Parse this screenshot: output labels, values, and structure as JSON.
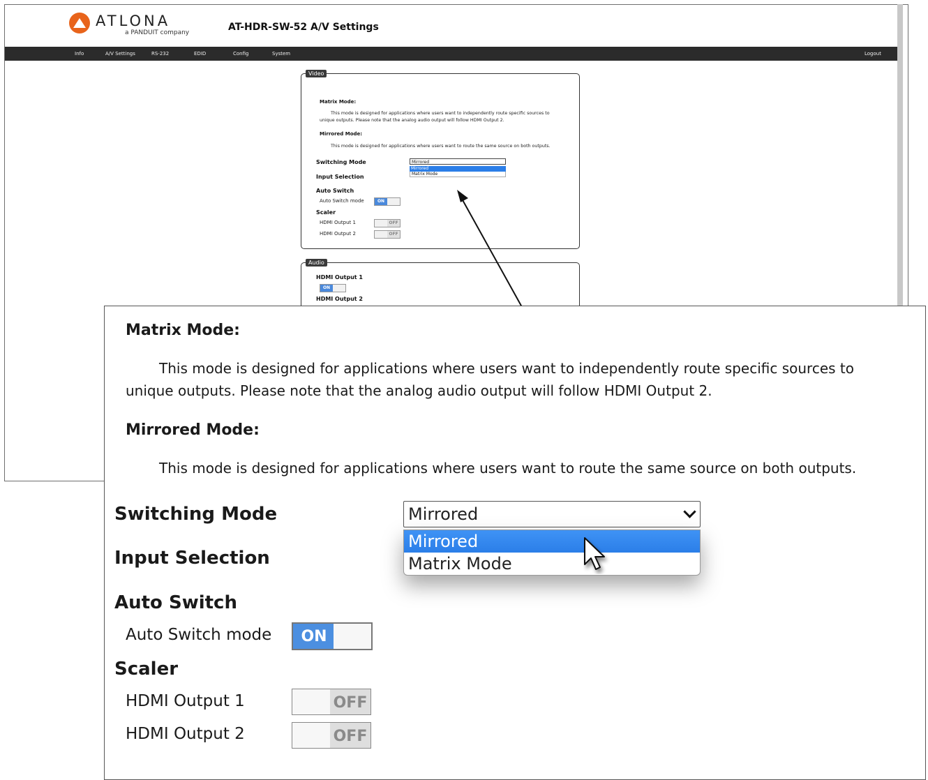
{
  "brand": {
    "logo_text": "ATLONA",
    "tagline": "a PANDUIT company"
  },
  "page": {
    "title": "AT-HDR-SW-52  A/V Settings"
  },
  "nav": {
    "items": [
      "Info",
      "A/V Settings",
      "RS-232",
      "EDID",
      "Config",
      "System"
    ],
    "logout": "Logout"
  },
  "video": {
    "legend": "Video",
    "matrix_mode_heading": "Matrix Mode:",
    "matrix_mode_text_1": "This mode is designed for applications where users want to independently route specific sources to",
    "matrix_mode_text_2": "unique outputs. Please note that the analog audio output will follow HDMI Output 2.",
    "mirrored_mode_heading": "Mirrored Mode:",
    "mirrored_mode_text": "This mode is designed for applications where users want to route the same source on both outputs.",
    "switching_mode_label": "Switching Mode",
    "switching_mode_value": "Mirrored",
    "switching_mode_options": [
      "Mirrored",
      "Matrix Mode"
    ],
    "input_selection_label": "Input Selection",
    "auto_switch_label": "Auto Switch",
    "auto_switch_mode_label": "Auto Switch mode",
    "auto_switch_state": "ON",
    "scaler_label": "Scaler",
    "hdmi_output_1_label": "HDMI Output 1",
    "hdmi_output_1_state": "OFF",
    "hdmi_output_2_label": "HDMI Output 2",
    "hdmi_output_2_state": "OFF"
  },
  "audio": {
    "legend": "Audio",
    "hdmi_output_1_label": "HDMI Output 1",
    "hdmi_output_1_state": "ON",
    "hdmi_output_2_label": "HDMI Output 2"
  },
  "colors": {
    "accent": "#4c8fe0",
    "navbar": "#2b2b2b",
    "logo": "#e8641b",
    "selected_option": "#2b7ee8"
  }
}
